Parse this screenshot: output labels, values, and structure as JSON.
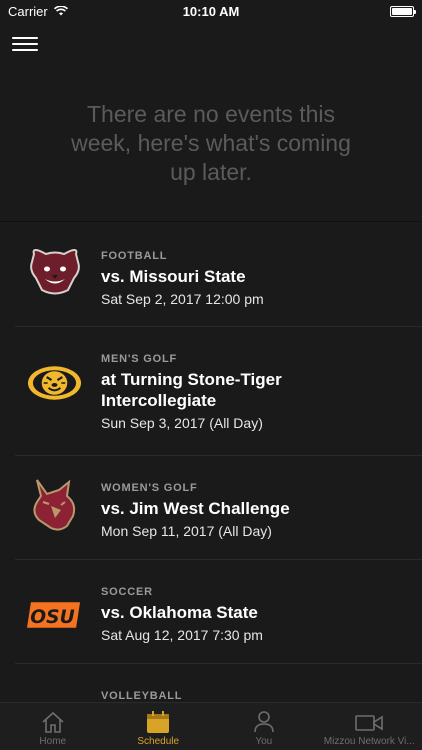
{
  "status_bar": {
    "carrier": "Carrier",
    "time": "10:10 AM"
  },
  "empty_state": {
    "message": "There are no events this week, here's what's coming up later."
  },
  "events": [
    {
      "sport": "FOOTBALL",
      "title": "vs. Missouri State",
      "date": "Sat Sep 2, 2017 12:00 pm",
      "logo": "missouri-state-bear-logo"
    },
    {
      "sport": "MEN'S GOLF",
      "title": "at Turning Stone-Tiger Intercollegiate",
      "date": "Sun Sep 3, 2017 (All Day)",
      "logo": "mizzou-tiger-logo"
    },
    {
      "sport": "WOMEN'S GOLF",
      "title": "vs. Jim West Challenge",
      "date": "Mon Sep 11, 2017 (All Day)",
      "logo": "texas-state-bobcat-logo"
    },
    {
      "sport": "SOCCER",
      "title": "vs. Oklahoma State",
      "date": "Sat Aug 12, 2017 7:30 pm",
      "logo": "osu-logo"
    },
    {
      "sport": "VOLLEYBALL",
      "title": "",
      "date": "",
      "logo": ""
    }
  ],
  "tabs": [
    {
      "label": "Home",
      "icon": "home-icon"
    },
    {
      "label": "Schedule",
      "icon": "calendar-icon",
      "active": true
    },
    {
      "label": "You",
      "icon": "person-icon"
    },
    {
      "label": "Mizzou Network Vi...",
      "icon": "video-icon"
    }
  ],
  "colors": {
    "background": "#1a1a1a",
    "accent": "#d8a427",
    "muted_text": "#5b5b5b"
  }
}
